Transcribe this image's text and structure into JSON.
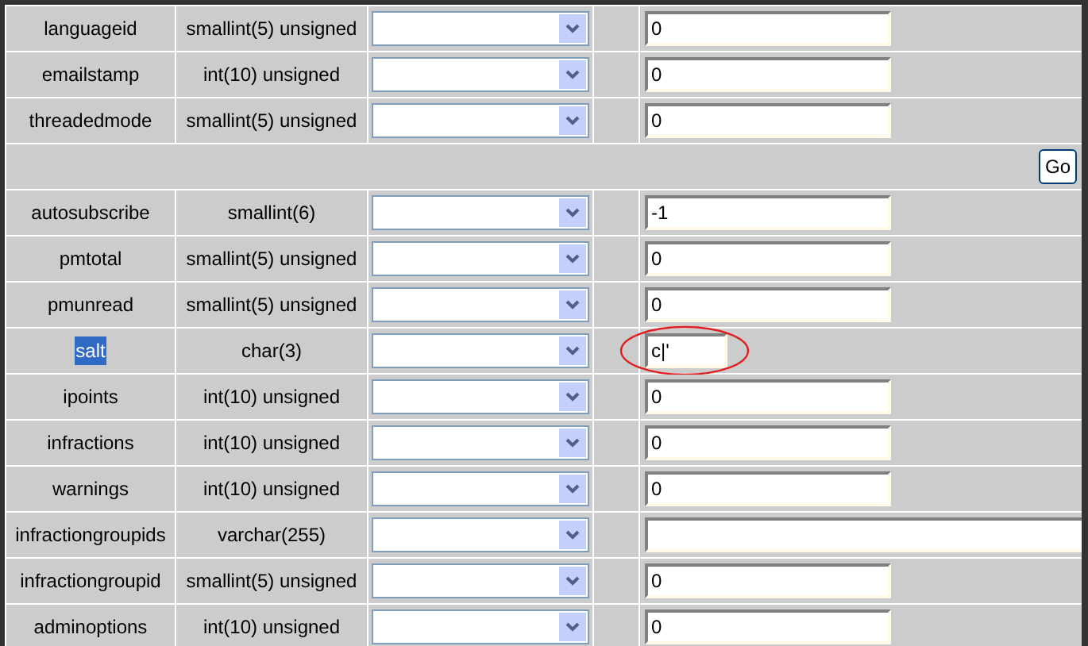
{
  "rows": [
    {
      "kind": "field",
      "name": "languageid",
      "highlighted": false,
      "type": "smallint(5) unsigned",
      "value": "0",
      "short": false,
      "wide": false,
      "circled": false
    },
    {
      "kind": "field",
      "name": "emailstamp",
      "highlighted": false,
      "type": "int(10) unsigned",
      "value": "0",
      "short": false,
      "wide": false,
      "circled": false
    },
    {
      "kind": "field",
      "name": "threadedmode",
      "highlighted": false,
      "type": "smallint(5) unsigned",
      "value": "0",
      "short": false,
      "wide": false,
      "circled": false
    },
    {
      "kind": "submit",
      "button": "Go"
    },
    {
      "kind": "field",
      "name": "autosubscribe",
      "highlighted": false,
      "type": "smallint(6)",
      "value": "-1",
      "short": false,
      "wide": false,
      "circled": false
    },
    {
      "kind": "field",
      "name": "pmtotal",
      "highlighted": false,
      "type": "smallint(5) unsigned",
      "value": "0",
      "short": false,
      "wide": false,
      "circled": false
    },
    {
      "kind": "field",
      "name": "pmunread",
      "highlighted": false,
      "type": "smallint(5) unsigned",
      "value": "0",
      "short": false,
      "wide": false,
      "circled": false
    },
    {
      "kind": "field",
      "name": "salt",
      "highlighted": true,
      "type": "char(3)",
      "value": "c|'",
      "short": true,
      "wide": false,
      "circled": true
    },
    {
      "kind": "field",
      "name": "ipoints",
      "highlighted": false,
      "type": "int(10) unsigned",
      "value": "0",
      "short": false,
      "wide": false,
      "circled": false
    },
    {
      "kind": "field",
      "name": "infractions",
      "highlighted": false,
      "type": "int(10) unsigned",
      "value": "0",
      "short": false,
      "wide": false,
      "circled": false
    },
    {
      "kind": "field",
      "name": "warnings",
      "highlighted": false,
      "type": "int(10) unsigned",
      "value": "0",
      "short": false,
      "wide": false,
      "circled": false
    },
    {
      "kind": "field",
      "name": "infractiongroupids",
      "highlighted": false,
      "type": "varchar(255)",
      "short": false,
      "wide": true,
      "circled": false
    },
    {
      "kind": "field",
      "name": "infractiongroupid",
      "highlighted": false,
      "type": "smallint(5) unsigned",
      "value": "0",
      "short": false,
      "wide": false,
      "circled": false
    },
    {
      "kind": "field",
      "name": "adminoptions",
      "highlighted": false,
      "type": "int(10) unsigned",
      "value": "0",
      "short": false,
      "wide": false,
      "circled": false
    }
  ]
}
